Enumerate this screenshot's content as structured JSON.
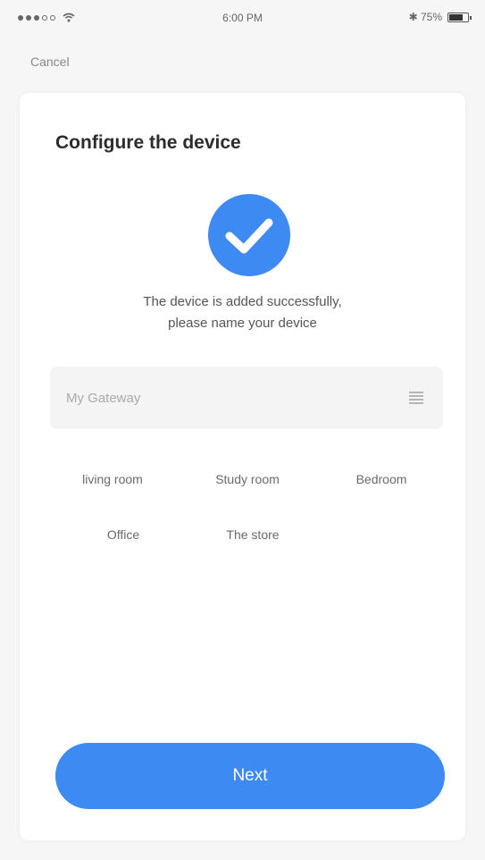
{
  "status_bar": {
    "time": "6:00 PM",
    "battery_text": "✱ 75%"
  },
  "nav": {
    "cancel_label": "Cancel"
  },
  "page": {
    "title": "Configure the device",
    "success_line1": "The device is added successfully,",
    "success_line2": "please name your device"
  },
  "name_input": {
    "placeholder": "My Gateway",
    "value": ""
  },
  "suggestions": [
    {
      "label": "living room"
    },
    {
      "label": "Study room"
    },
    {
      "label": "Bedroom"
    },
    {
      "label": "Office"
    },
    {
      "label": "The store"
    }
  ],
  "actions": {
    "next_label": "Next"
  },
  "colors": {
    "accent": "#3d8af2",
    "background": "#f6f6f6",
    "card": "#ffffff",
    "input_bg": "#f4f4f4"
  },
  "icons": {
    "success": "check-circle-icon",
    "list": "list-icon",
    "wifi": "wifi-icon",
    "battery": "battery-icon"
  }
}
